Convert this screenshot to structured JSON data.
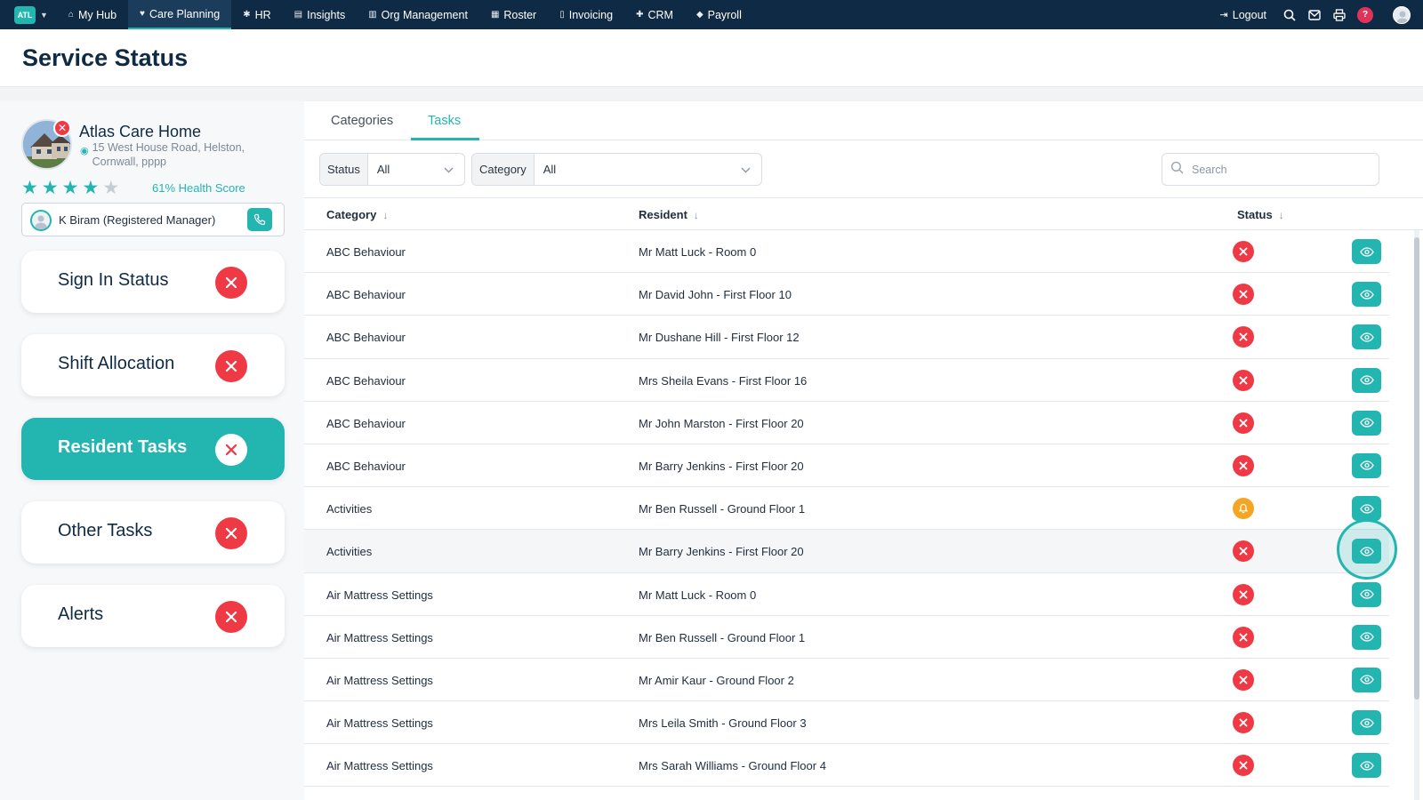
{
  "nav": {
    "logo": "ATL",
    "items": [
      {
        "label": "My Hub",
        "icon": "home-icon",
        "active": false
      },
      {
        "label": "Care Planning",
        "icon": "heart-icon",
        "active": true
      },
      {
        "label": "HR",
        "icon": "people-icon",
        "active": false
      },
      {
        "label": "Insights",
        "icon": "chart-icon",
        "active": false
      },
      {
        "label": "Org Management",
        "icon": "building-icon",
        "active": false
      },
      {
        "label": "Roster",
        "icon": "calendar-icon",
        "active": false
      },
      {
        "label": "Invoicing",
        "icon": "document-icon",
        "active": false
      },
      {
        "label": "CRM",
        "icon": "person-plus-icon",
        "active": false
      },
      {
        "label": "Payroll",
        "icon": "tag-icon",
        "active": false
      }
    ],
    "logout": "Logout",
    "help": "?"
  },
  "page": {
    "title": "Service Status"
  },
  "home": {
    "name": "Atlas Care Home",
    "address": "15 West House Road, Helston, Cornwall, pppp",
    "rating": 4,
    "rating_max": 5,
    "health_score": "61% Health Score",
    "manager": "K Biram (Registered Manager)"
  },
  "status_cards": [
    {
      "label": "Sign In Status",
      "active": false
    },
    {
      "label": "Shift Allocation",
      "active": false
    },
    {
      "label": "Resident Tasks",
      "active": true
    },
    {
      "label": "Other Tasks",
      "active": false
    },
    {
      "label": "Alerts",
      "active": false
    }
  ],
  "tabs": [
    {
      "label": "Categories",
      "active": false
    },
    {
      "label": "Tasks",
      "active": true
    }
  ],
  "filters": {
    "status": {
      "label": "Status",
      "value": "All"
    },
    "category": {
      "label": "Category",
      "value": "All"
    },
    "search_placeholder": "Search"
  },
  "table": {
    "headers": {
      "category": "Category",
      "resident": "Resident",
      "status": "Status"
    },
    "rows": [
      {
        "category": "ABC Behaviour",
        "resident": "Mr Matt Luck - Room 0",
        "status": "cross"
      },
      {
        "category": "ABC Behaviour",
        "resident": "Mr David John - First Floor 10",
        "status": "cross"
      },
      {
        "category": "ABC Behaviour",
        "resident": "Mr Dushane Hill - First Floor 12",
        "status": "cross"
      },
      {
        "category": "ABC Behaviour",
        "resident": "Mrs Sheila Evans - First Floor 16",
        "status": "cross"
      },
      {
        "category": "ABC Behaviour",
        "resident": "Mr John Marston - First Floor 20",
        "status": "cross"
      },
      {
        "category": "ABC Behaviour",
        "resident": "Mr Barry Jenkins - First Floor 20",
        "status": "cross"
      },
      {
        "category": "Activities",
        "resident": "Mr Ben Russell - Ground Floor 1",
        "status": "bell"
      },
      {
        "category": "Activities",
        "resident": "Mr Barry Jenkins - First Floor 20",
        "status": "cross",
        "highlighted": true
      },
      {
        "category": "Air Mattress Settings",
        "resident": "Mr Matt Luck - Room 0",
        "status": "cross"
      },
      {
        "category": "Air Mattress Settings",
        "resident": "Mr Ben Russell - Ground Floor 1",
        "status": "cross"
      },
      {
        "category": "Air Mattress Settings",
        "resident": "Mr Amir Kaur - Ground Floor 2",
        "status": "cross"
      },
      {
        "category": "Air Mattress Settings",
        "resident": "Mrs Leila Smith - Ground Floor 3",
        "status": "cross"
      },
      {
        "category": "Air Mattress Settings",
        "resident": "Mrs Sarah Williams - Ground Floor 4",
        "status": "cross"
      }
    ]
  },
  "colors": {
    "nav_bg": "#0f2a44",
    "accent": "#23b5b0",
    "danger": "#ef3a46",
    "warning": "#f5a524"
  }
}
